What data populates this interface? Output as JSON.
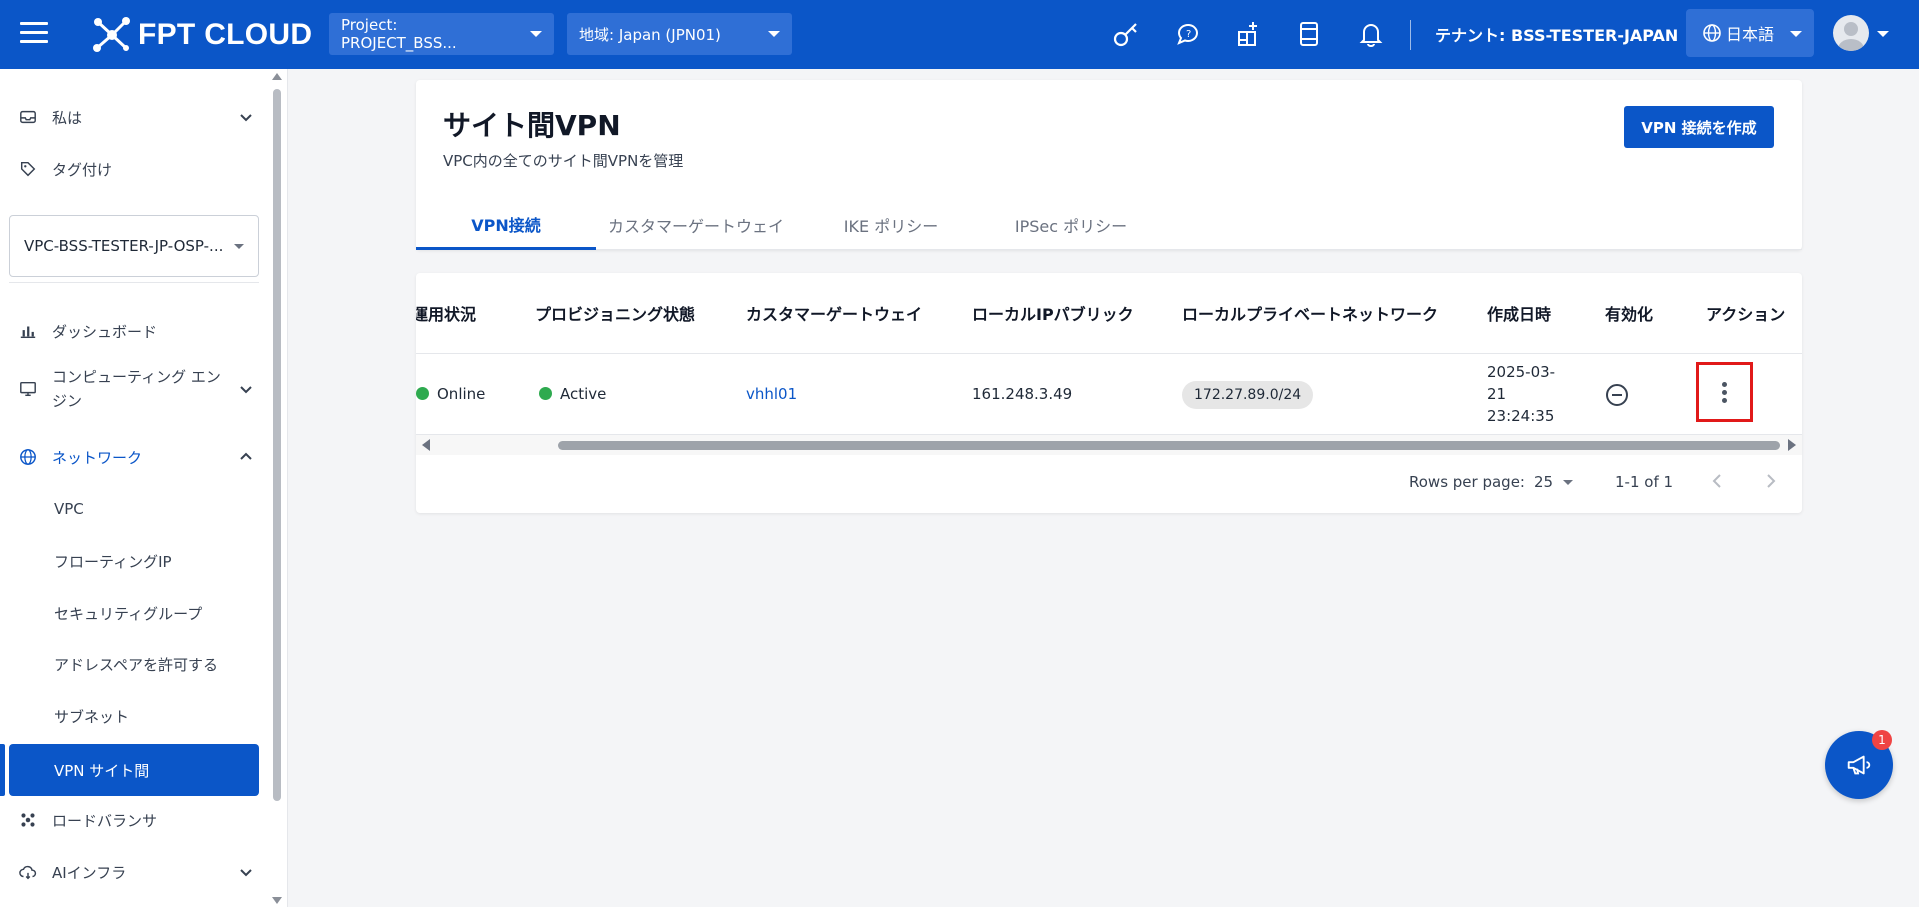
{
  "topbar": {
    "logo_text": "FPT CLOUD",
    "project_select": "Project: PROJECT_BSS...",
    "region_select": "地域: Japan (JPN01)",
    "icons": [
      "key-icon",
      "support-chat-icon",
      "apps-add-icon",
      "document-icon",
      "bell-icon"
    ],
    "tenant": "テナント: BSS-TESTER-JAPAN",
    "language": "日本語",
    "brand_color": "#0b56c8"
  },
  "sidebar": {
    "items": [
      {
        "label": "私は",
        "icon": "inbox-icon"
      },
      {
        "label": "タグ付け",
        "icon": "tag-icon"
      }
    ],
    "vpc_select": "VPC-BSS-TESTER-JP-OSP-...",
    "nav": [
      {
        "label": "ダッシュボード",
        "icon": "bar-chart-icon"
      },
      {
        "label": "コンピューティング エンジン",
        "icon": "monitor-icon"
      },
      {
        "label": "ネットワーク",
        "icon": "globe-icon"
      }
    ],
    "network_children": [
      "VPC",
      "フローティングIP",
      "セキュリティグループ",
      "アドレスペアを許可する",
      "サブネット",
      "VPN サイト間"
    ],
    "bottom": [
      {
        "label": "ロードバランサ",
        "icon": "load-balancer-icon"
      },
      {
        "label": "AIインフラ",
        "icon": "cloud-sync-icon"
      }
    ]
  },
  "page": {
    "title": "サイト間VPN",
    "subtitle": "VPC内の全てのサイト間VPNを管理",
    "create_button": "VPN 接続を作成",
    "tabs": [
      "VPN接続",
      "カスタマーゲートウェイ",
      "IKE ポリシー",
      "IPSec ポリシー"
    ],
    "active_tab": "VPN接続"
  },
  "table": {
    "columns": [
      "運用状況",
      "プロビジョニング状態",
      "カスタマーゲートウェイ",
      "ローカルIPパブリック",
      "ローカルプライベートネットワーク",
      "作成日時",
      "有効化",
      "アクション"
    ],
    "rows": [
      {
        "operating_status": "Online",
        "provisioning_status": "Active",
        "customer_gateway": "vhhl01",
        "local_ip_public": "161.248.3.49",
        "local_private_network": "172.27.89.0/24",
        "created_at": "2025-03-21 23:24:35",
        "enable_icon": "minus-circle-icon",
        "action_icon": "kebab-menu-icon"
      }
    ],
    "status_color": "#2eaa4f"
  },
  "pagination": {
    "rows_per_page_label": "Rows per page:",
    "rows_per_page": "25",
    "range": "1-1 of 1"
  },
  "fab": {
    "icon": "megaphone-icon",
    "badge": "1"
  }
}
